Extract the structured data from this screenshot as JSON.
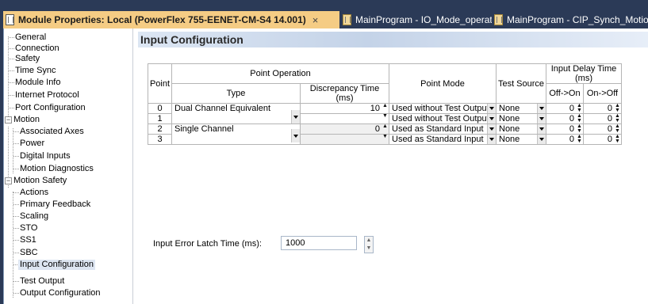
{
  "tabs": [
    {
      "label": "Module Properties: Local (PowerFlex 755-EENET-CM-S4 14.001)",
      "close": "×"
    },
    {
      "label": "MainProgram - IO_Mode_operation"
    },
    {
      "label": "MainProgram - CIP_Synch_Motion_c"
    }
  ],
  "tree": {
    "expanders": {
      "motion": "−",
      "motion_safety": "−"
    },
    "items": [
      "General",
      "Connection",
      "Safety",
      "Time Sync",
      "Module Info",
      "Internet Protocol",
      "Port Configuration",
      "Motion",
      "Associated Axes",
      "Power",
      "Digital Inputs",
      "Motion Diagnostics",
      "Motion Safety",
      "Actions",
      "Primary Feedback",
      "Scaling",
      "STO",
      "SS1",
      "SBC",
      "Input Configuration",
      "Test Output",
      "Output Configuration"
    ],
    "selected": "Input Configuration"
  },
  "page": {
    "title": "Input Configuration"
  },
  "table": {
    "headers": {
      "point": "Point",
      "point_operation": "Point Operation",
      "type": "Type",
      "discrepancy": "Discrepancy Time (ms)",
      "point_mode": "Point Mode",
      "test_source": "Test Source",
      "input_delay": "Input Delay Time (ms)",
      "off_on": "Off->On",
      "on_off": "On->Off"
    },
    "rows": [
      {
        "point": "0",
        "type": "Dual Channel Equivalent",
        "discrepancy": "10",
        "mode": "Used without Test Output",
        "test_source": "None",
        "off_on": "0",
        "on_off": "0"
      },
      {
        "point": "1",
        "type": "",
        "discrepancy": "",
        "mode": "Used without Test Output",
        "test_source": "None",
        "off_on": "0",
        "on_off": "0"
      },
      {
        "point": "2",
        "type": "Single Channel",
        "discrepancy": "0",
        "mode": "Used as Standard Input",
        "test_source": "None",
        "off_on": "0",
        "on_off": "0"
      },
      {
        "point": "3",
        "type": "",
        "discrepancy": "",
        "mode": "Used as Standard Input",
        "test_source": "None",
        "off_on": "0",
        "on_off": "0"
      }
    ]
  },
  "latch": {
    "label": "Input Error Latch Time (ms):",
    "value": "1000"
  },
  "icons": {
    "spin_up": "▲",
    "spin_down": "▼"
  },
  "colors": {
    "active_tab": "#f5cc84",
    "tab_strip": "#2b3a57",
    "header_bar": "#c4d3e8",
    "selected_row": "#dde5f1"
  }
}
